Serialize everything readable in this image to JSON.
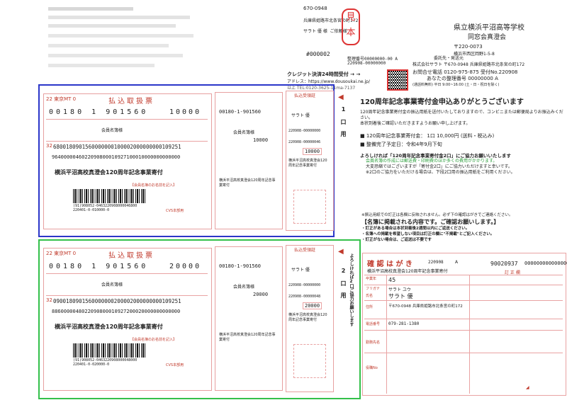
{
  "header_left": {
    "zip": "670-0948",
    "addr": "兵庫県姫路市北条宮の町172",
    "name": "サラト 優 様",
    "dear": "ご依頼様"
  },
  "stamp": {
    "a": "見",
    "b": "本"
  },
  "header_right": {
    "org": "県立横浜平沼高等学校",
    "org2": "同窓会真澄会",
    "zip": "〒220-0073",
    "addr": "横浜市西区岡野1-5-8"
  },
  "ref": {
    "no": "#000002",
    "reg": "整理番号00000000-00 A",
    "code": "220908-00000000"
  },
  "contact": {
    "line1": "委託先・発送元",
    "line2": "株式会社サラト 〒670-0948 兵庫県姫路市北条宮の町172",
    "phone": "お問合せ電話 0120-975-875 受付No.220908",
    "sort": "あなたの整理番号 00000000 A",
    "hours": "(通話料無料) 平日 9:00~16:00 (土・日・祝日を除く)"
  },
  "credit": {
    "title": "クレジット決済24時間受付 → →",
    "url": "アドレス：https://www.dousoukai.ne.jp/",
    "tel": "以上 TEL:0120-3625-11ma-7137"
  },
  "letter": {
    "title": "120周年記念事業寄付金申込ありがとうございます",
    "p1": "120周年記念事業寄付金の振込用紙を送付いたしておりますので、コンビニまたは郵便局よりお振込みください。",
    "p2": "本状到着後ご確認いただきますようお願い申し上げます。",
    "b1": "■ 120周年記念事業寄付金： 1口 10,000円 (送料・税込み)",
    "b2": "■ 整備完了予定日：令和4年9月下旬",
    "b3": "よろしければ「120周年記念事業寄付金2口」にご協力お願いいたします",
    "b4": "会員名簿の作成には郵送費・印刷費のほか多くの費用がかかります。",
    "b5": "大変恐縮ではございますが「寄付金2口」にご協力いただけますと幸いです。",
    "b6": "※2口のご協力をいただける場合は、下段2口用の振込用紙をご利用ください。"
  },
  "notice": {
    "t1": "※振込用紙での訂正は各欄に反映されません。必ず下の確認はがきでご連絡ください。",
    "t2": "【名簿に掲載される内容です。ご確認お願いします。】",
    "t3": "・訂正がある場合は本状到着後2週間以内にご返送ください。",
    "t4": "・名簿への掲載を希望しない項目は訂正の欄に\"不掲載\"とご記入ください。",
    "t5": "・訂正がない場合は、ご返送は不要です"
  },
  "slip1": {
    "title": "払込取扱票",
    "acct": "00180",
    "acct2": "1",
    "acct3": "901560",
    "amount": "10000",
    "member": "会員名簿様",
    "num1": "6800180901560000000100002000000000109251",
    "num2": "9640000046022090800010927100010000000000000",
    "purpose": "横浜平沼高校真澄会120周年記念事業寄付",
    "note": "【会員名簿のお名前を記入】",
    "barnum": "(91)908052-0463220908000046800",
    "barnum2": "220401-0-010000-0",
    "cvs": "CVS本部用",
    "recv": "払込受領証",
    "recv_acct": "00180",
    "recv_acct2": "1",
    "recv_acct3": "901560",
    "recv_amount": "10000",
    "recv_code": "220908-00000000",
    "recv_code2": "220908-00000046",
    "recv_purpose": "横浜平沼高校真澄会120周年記念事業寄付",
    "name": "サラト 優",
    "side": "1 口 用"
  },
  "slip2": {
    "title": "払込取扱票",
    "acct": "00180",
    "acct2": "1",
    "acct3": "901560",
    "amount": "20000",
    "member": "会員名簿様",
    "num1": "0900180901560000000200002000000000109251",
    "num2": "8860000048022090800010927200020000000000000",
    "purpose": "横浜平沼高校真澄会120周年記念事業寄付",
    "note": "【会員名簿のお名前を記入】",
    "barnum": "(91)908052-0463220908000048000",
    "barnum2": "220401-0-020000-0",
    "cvs": "CVS本部用",
    "recv": "払込受領証",
    "recv_acct": "00180",
    "recv_acct2": "1",
    "recv_acct3": "901560",
    "recv_amount": "20000",
    "recv_code": "220908-00000000",
    "recv_code2": "220908-00000048",
    "recv_purpose": "横浜平沼高校真澄会120周年記念事業寄付",
    "name": "サラト 優",
    "side": "2 口 用",
    "side2": "よろしければ2口ご協力お願いします"
  },
  "card": {
    "title": "確 認 は が き",
    "code": "220908",
    "rank": "A",
    "no": "90020937",
    "no2": "000000000000000",
    "org": "横浜平沼高校真澄会120周年記念事業寄付",
    "name": "サラト 優",
    "kana": "サラト ユウ",
    "num": "45",
    "zip": "〒670-0948 兵庫県姫路市北条宮の町172",
    "tel": "079-281-1380",
    "l1": "卒業年",
    "l2": "フリガナ",
    "l3": "氏名",
    "l4": "住所",
    "l5": "電話番号",
    "l6": "勤務先名",
    "l7": "役職No",
    "hdr": "訂 正 欄"
  }
}
